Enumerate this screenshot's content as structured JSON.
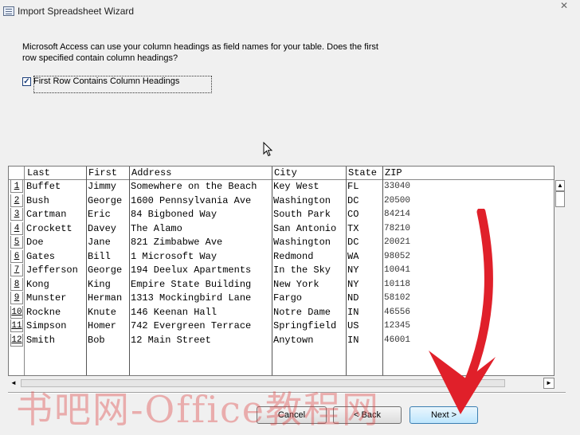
{
  "window": {
    "title": "Import Spreadsheet Wizard",
    "close_label": "✕"
  },
  "description": "Microsoft Access can use your column headings as field names for your table. Does the first row specified contain column headings?",
  "checkbox": {
    "label": "First Row Contains Column Headings",
    "checked": true,
    "check_glyph": "✓"
  },
  "grid": {
    "columns": [
      "Last",
      "First",
      "Address",
      "City",
      "State",
      "ZIP"
    ],
    "rows": [
      {
        "n": "1",
        "cells": [
          "Buffet",
          "Jimmy",
          "Somewhere on the Beach",
          "Key West",
          "FL",
          "33040"
        ]
      },
      {
        "n": "2",
        "cells": [
          "Bush",
          "George",
          "1600 Pennsylvania Ave",
          "Washington",
          "DC",
          "20500"
        ]
      },
      {
        "n": "3",
        "cells": [
          "Cartman",
          "Eric",
          "84 Bigboned Way",
          "South Park",
          "CO",
          "84214"
        ]
      },
      {
        "n": "4",
        "cells": [
          "Crockett",
          "Davey",
          "The Alamo",
          "San Antonio",
          "TX",
          "78210"
        ]
      },
      {
        "n": "5",
        "cells": [
          "Doe",
          "Jane",
          "821 Zimbabwe Ave",
          "Washington",
          "DC",
          "20021"
        ]
      },
      {
        "n": "6",
        "cells": [
          "Gates",
          "Bill",
          "1 Microsoft Way",
          "Redmond",
          "WA",
          "98052"
        ]
      },
      {
        "n": "7",
        "cells": [
          "Jefferson",
          "George",
          "194 Deelux Apartments",
          "In the Sky",
          "NY",
          "10041"
        ]
      },
      {
        "n": "8",
        "cells": [
          "Kong",
          "King",
          "Empire State Building",
          "New York",
          "NY",
          "10118"
        ]
      },
      {
        "n": "9",
        "cells": [
          "Munster",
          "Herman",
          "1313 Mockingbird Lane",
          "Fargo",
          "ND",
          "58102"
        ]
      },
      {
        "n": "10",
        "cells": [
          "Rockne",
          "Knute",
          "146 Keenan Hall",
          "Notre Dame",
          "IN",
          "46556"
        ]
      },
      {
        "n": "11",
        "cells": [
          "Simpson",
          "Homer",
          "742 Evergreen Terrace",
          "Springfield",
          "US",
          "12345"
        ]
      },
      {
        "n": "12",
        "cells": [
          "Smith",
          "Bob",
          "12 Main Street",
          "Anytown",
          "IN",
          "46001"
        ]
      }
    ]
  },
  "scroll": {
    "up": "▲",
    "left": "◄",
    "right": "►"
  },
  "buttons": {
    "cancel": "Cancel",
    "back": "< Back",
    "next": "Next >"
  },
  "watermark": "书吧网-Office教程网",
  "colors": {
    "arrow": "#e0202a",
    "watermark": "#dc3c3c"
  }
}
